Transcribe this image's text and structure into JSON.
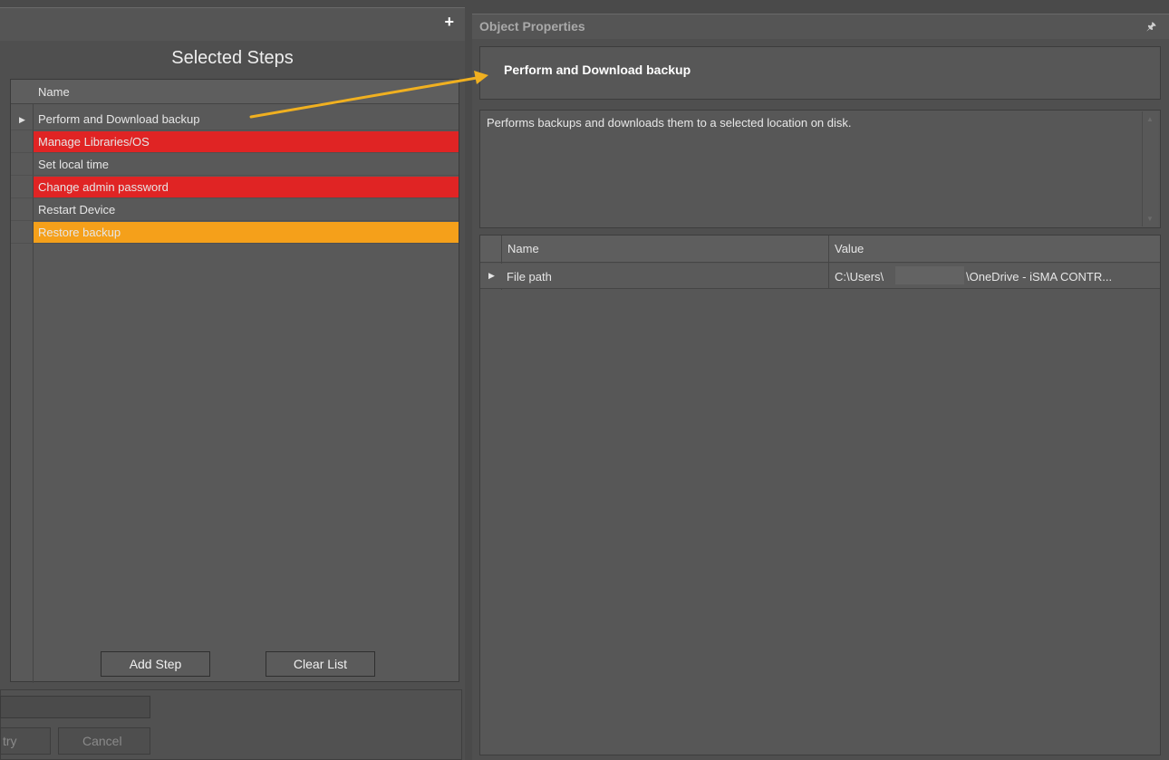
{
  "left_panel": {
    "plus_icon": "+",
    "title": "Selected Steps",
    "grid": {
      "column_header": "Name",
      "rows": [
        {
          "label": "Perform and Download backup",
          "bg": "#595959",
          "selected": true
        },
        {
          "label": "Manage Libraries/OS",
          "bg": "#e02424",
          "selected": false
        },
        {
          "label": "Set local time",
          "bg": "#595959",
          "selected": false
        },
        {
          "label": "Change admin password",
          "bg": "#e02424",
          "selected": false
        },
        {
          "label": "Restart Device",
          "bg": "#595959",
          "selected": false
        },
        {
          "label": "Restore backup",
          "bg": "#f5a01a",
          "selected": false
        }
      ]
    },
    "add_step_label": "Add Step",
    "clear_list_label": "Clear List",
    "bottom": {
      "retry_label": "try",
      "cancel_label": "Cancel"
    }
  },
  "right_panel": {
    "header_title": "Object Properties",
    "pin_icon": "pin-icon",
    "object_title": "Perform and Download backup",
    "description": "Performs backups and downloads them to a selected location on disk.",
    "grid": {
      "name_header": "Name",
      "value_header": "Value",
      "rows": [
        {
          "name": "File path",
          "value_prefix": "C:\\Users\\",
          "value_suffix": "\\OneDrive - iSMA CONTR..."
        }
      ]
    }
  },
  "colors": {
    "annotation_arrow": "#f0b020",
    "error_row": "#e02424",
    "warning_row": "#f5a01a"
  }
}
